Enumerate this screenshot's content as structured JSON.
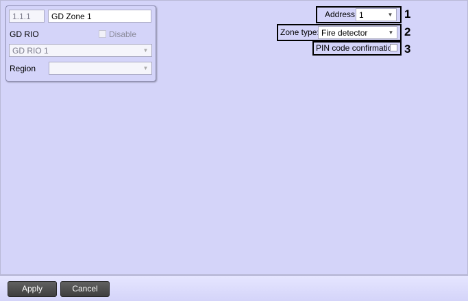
{
  "object": {
    "id": "1.1.1",
    "name": "GD Zone 1",
    "parent_label": "GD RIO",
    "disable_label": "Disable",
    "parent_value": "GD RIO 1",
    "region_label": "Region",
    "region_value": ""
  },
  "settings": {
    "address_label": "Address:",
    "address_value": "1",
    "zone_type_label": "Zone type:",
    "zone_type_value": "Fire detector",
    "pin_label": "PIN code confirmation"
  },
  "callouts": [
    "1",
    "2",
    "3"
  ],
  "footer": {
    "apply_label": "Apply",
    "cancel_label": "Cancel"
  }
}
